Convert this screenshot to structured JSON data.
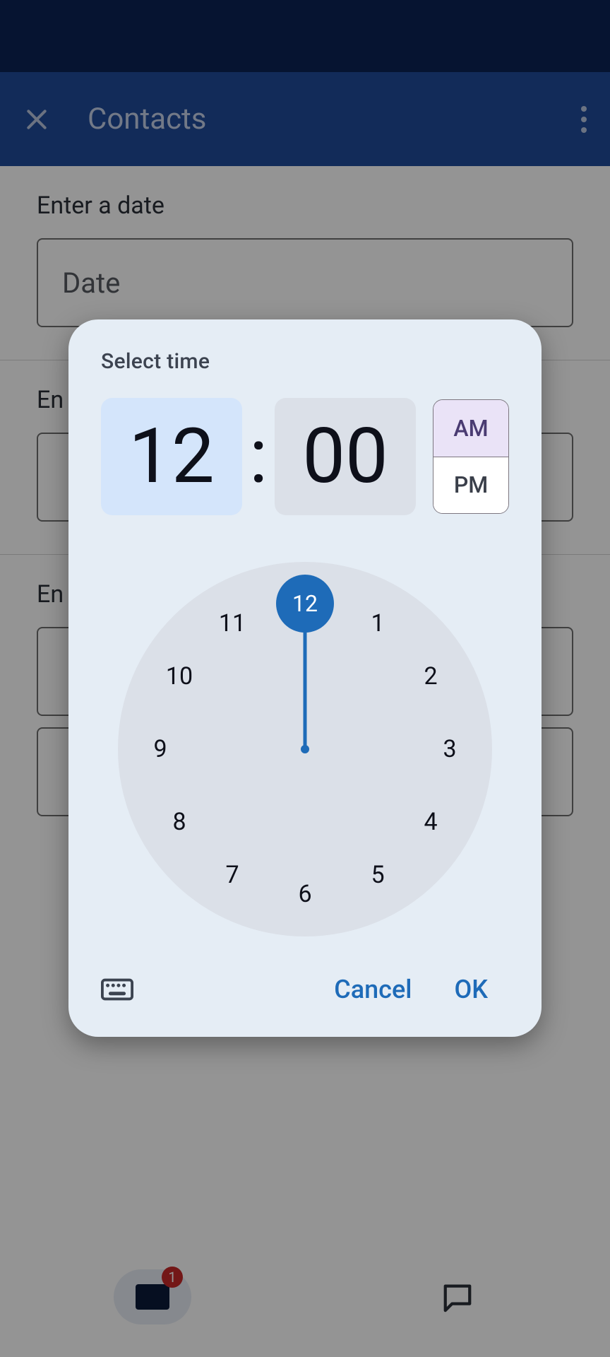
{
  "appbar": {
    "title": "Contacts"
  },
  "form": {
    "date": {
      "label": "Enter a date",
      "placeholder": "Date"
    },
    "time": {
      "label_prefix": "En"
    },
    "extra": {
      "label_prefix": "En"
    }
  },
  "bottom_nav": {
    "badge": "1"
  },
  "picker": {
    "title": "Select time",
    "hour": "12",
    "minute": "00",
    "am": "AM",
    "pm": "PM",
    "numbers": {
      "n1": "1",
      "n2": "2",
      "n3": "3",
      "n4": "4",
      "n5": "5",
      "n6": "6",
      "n7": "7",
      "n8": "8",
      "n9": "9",
      "n10": "10",
      "n11": "11",
      "n12": "12"
    },
    "cancel": "Cancel",
    "ok": "OK"
  }
}
